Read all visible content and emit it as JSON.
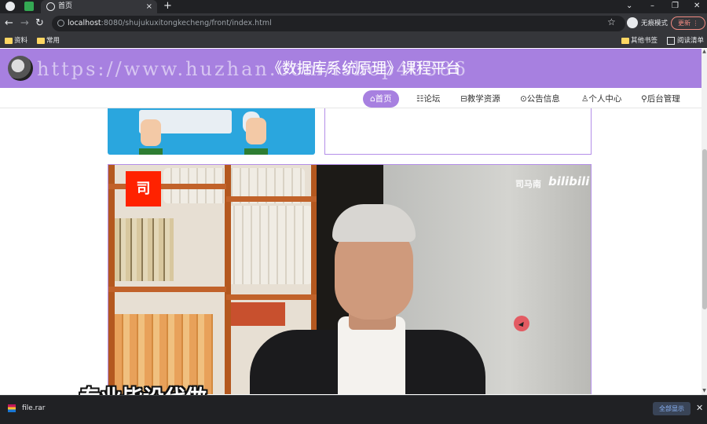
{
  "browser": {
    "tab_title": "首页",
    "tab_close": "×",
    "new_tab": "+",
    "window_controls": {
      "dropdown": "⌄",
      "minimize": "–",
      "restore": "❐",
      "close": "✕"
    },
    "nav": {
      "back": "←",
      "forward": "→",
      "reload": "↻"
    },
    "url_host": "localhost",
    "url_path": ":8080/shujukuxitongkecheng/front/index.html",
    "star": "☆",
    "incognito_label": "无痕模式",
    "update_label": "更新 ⋮",
    "bookmarks": [
      "资料",
      "常用"
    ],
    "bookmarks_right": [
      "其他书签",
      "阅读清单"
    ]
  },
  "site": {
    "watermark_url": "https://www.huzhan.com/ishop40386",
    "title": "《数据库系统原理》课程平台",
    "nav": [
      "⌂首页",
      "☷论坛",
      "⊟教学资源",
      "⊙公告信息",
      "♙个人中心",
      "⚲后台管理"
    ],
    "active_nav_index": 0
  },
  "video": {
    "logo_char": "司",
    "credit": "司马南",
    "platform": "bilibili",
    "caption": "专业毕设代做"
  },
  "downloads": {
    "file_name": "file.rar",
    "show_all": "全部显示",
    "close": "✕"
  },
  "colors": {
    "header_purple": "#a780e0",
    "active_nav": "#a780e0",
    "browser_dark": "#202124"
  }
}
